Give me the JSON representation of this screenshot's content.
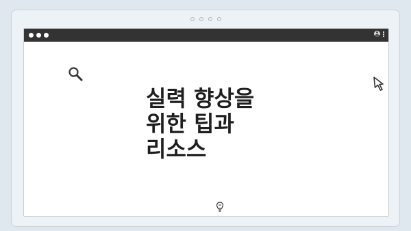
{
  "window": {
    "title_bar": {
      "controls": [
        "close-dot",
        "minimize-dot",
        "zoom-dot"
      ],
      "right_icons": [
        "user-icon",
        "kebab-menu-icon"
      ]
    },
    "content": {
      "headline": "실력 향상을\n위한 팁과\n리소스",
      "icons": [
        "search-icon",
        "cursor-icon",
        "lightbulb-icon"
      ]
    }
  },
  "colors": {
    "background": "#dfe7ef",
    "titlebar": "#333333",
    "content": "#ffffff",
    "text": "#1e1e1e"
  }
}
